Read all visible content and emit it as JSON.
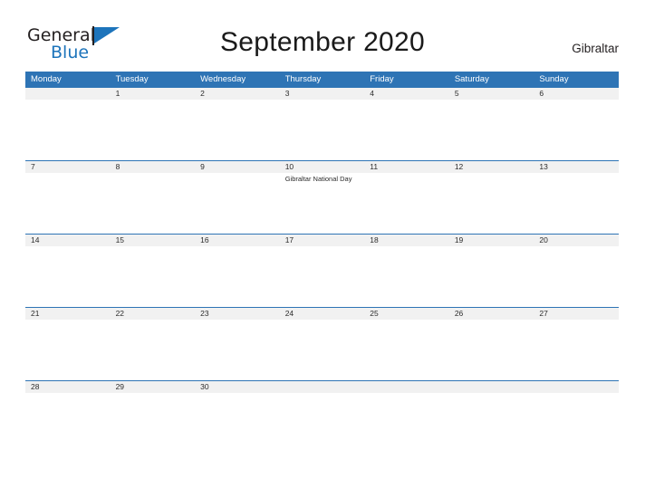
{
  "brand": {
    "name_part1": "General",
    "name_part2": "Blue",
    "flag_icon": "blue-flag-icon"
  },
  "header": {
    "title": "September 2020",
    "region": "Gibraltar"
  },
  "calendar": {
    "month": "September",
    "year": "2020",
    "colors": {
      "header_blue": "#2e74b5",
      "row_gray": "#f1f1f1",
      "line_blue": "#2e74b5",
      "brand_blue": "#1d74bb"
    },
    "weekdays": [
      "Monday",
      "Tuesday",
      "Wednesday",
      "Thursday",
      "Friday",
      "Saturday",
      "Sunday"
    ],
    "weeks": [
      {
        "days": [
          {
            "num": "",
            "events": ""
          },
          {
            "num": "1",
            "events": ""
          },
          {
            "num": "2",
            "events": ""
          },
          {
            "num": "3",
            "events": ""
          },
          {
            "num": "4",
            "events": ""
          },
          {
            "num": "5",
            "events": ""
          },
          {
            "num": "6",
            "events": ""
          }
        ]
      },
      {
        "days": [
          {
            "num": "7",
            "events": ""
          },
          {
            "num": "8",
            "events": ""
          },
          {
            "num": "9",
            "events": ""
          },
          {
            "num": "10",
            "events": "Gibraltar National Day"
          },
          {
            "num": "11",
            "events": ""
          },
          {
            "num": "12",
            "events": ""
          },
          {
            "num": "13",
            "events": ""
          }
        ]
      },
      {
        "days": [
          {
            "num": "14",
            "events": ""
          },
          {
            "num": "15",
            "events": ""
          },
          {
            "num": "16",
            "events": ""
          },
          {
            "num": "17",
            "events": ""
          },
          {
            "num": "18",
            "events": ""
          },
          {
            "num": "19",
            "events": ""
          },
          {
            "num": "20",
            "events": ""
          }
        ]
      },
      {
        "days": [
          {
            "num": "21",
            "events": ""
          },
          {
            "num": "22",
            "events": ""
          },
          {
            "num": "23",
            "events": ""
          },
          {
            "num": "24",
            "events": ""
          },
          {
            "num": "25",
            "events": ""
          },
          {
            "num": "26",
            "events": ""
          },
          {
            "num": "27",
            "events": ""
          }
        ]
      },
      {
        "days": [
          {
            "num": "28",
            "events": ""
          },
          {
            "num": "29",
            "events": ""
          },
          {
            "num": "30",
            "events": ""
          },
          {
            "num": "",
            "events": ""
          },
          {
            "num": "",
            "events": ""
          },
          {
            "num": "",
            "events": ""
          },
          {
            "num": "",
            "events": ""
          }
        ]
      }
    ]
  }
}
